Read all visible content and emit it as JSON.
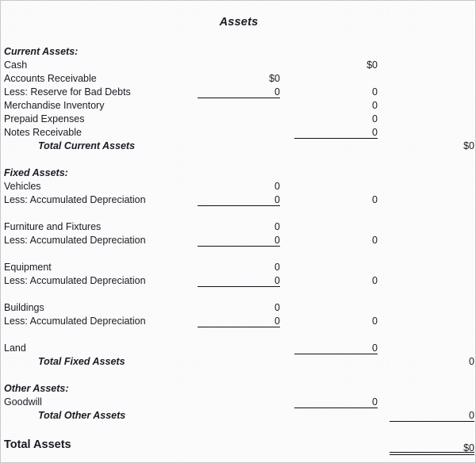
{
  "document": {
    "title": "Assets",
    "type": "balance-sheet-assets-section"
  },
  "sections": {
    "current_assets": {
      "heading": "Current Assets:",
      "total_label": "Total Current Assets",
      "total_value": "$0",
      "lines": [
        {
          "label": "Cash",
          "col1": "",
          "col2": "$0"
        },
        {
          "label": "Accounts Receivable",
          "col1": "$0",
          "col2": ""
        },
        {
          "label": "Less:  Reserve for Bad Debts",
          "col1": "0",
          "col2": "0"
        },
        {
          "label": "Merchandise Inventory",
          "col1": "",
          "col2": "0"
        },
        {
          "label": "Prepaid Expenses",
          "col1": "",
          "col2": "0"
        },
        {
          "label": "Notes Receivable",
          "col1": "",
          "col2": "0"
        }
      ]
    },
    "fixed_assets": {
      "heading": "Fixed Assets:",
      "total_label": "Total Fixed Assets",
      "total_value": "0",
      "groups": [
        {
          "asset_label": "Vehicles",
          "asset_cost": "0",
          "depreciation_label": "Less:  Accumulated Depreciation",
          "depreciation_value": "0",
          "net_value": "0"
        },
        {
          "asset_label": "Furniture and Fixtures",
          "asset_cost": "0",
          "depreciation_label": "Less:  Accumulated Depreciation",
          "depreciation_value": "0",
          "net_value": "0"
        },
        {
          "asset_label": "Equipment",
          "asset_cost": "0",
          "depreciation_label": "Less:  Accumulated Depreciation",
          "depreciation_value": "0",
          "net_value": "0"
        },
        {
          "asset_label": "Buildings",
          "asset_cost": "0",
          "depreciation_label": "Less:  Accumulated Depreciation",
          "depreciation_value": "0",
          "net_value": "0"
        }
      ],
      "land": {
        "label": "Land",
        "value": "0"
      }
    },
    "other_assets": {
      "heading": "Other Assets:",
      "total_label": "Total Other Assets",
      "total_value": "0",
      "lines": [
        {
          "label": "Goodwill",
          "col2": "0"
        }
      ]
    }
  },
  "grand_total": {
    "label": "Total Assets",
    "value": "$0"
  },
  "style": {
    "text_color": "#1a1a22",
    "rule_color": "#111117",
    "page_background": "#fdfdfd",
    "border_color": "#c8c8c8"
  }
}
